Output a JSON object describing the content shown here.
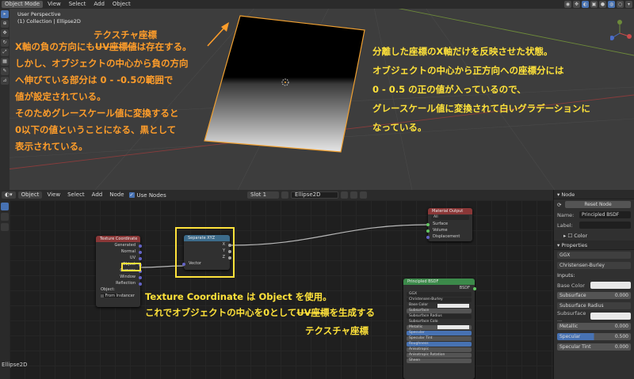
{
  "viewport": {
    "mode": "Object Mode",
    "menus": [
      "View",
      "Select",
      "Add",
      "Object"
    ],
    "info_line1": "User Perspective",
    "info_line2": "(1) Collection | Ellipse2D"
  },
  "annotations": {
    "left_title": "テクスチャ座標",
    "left_line1_a": "X軸の負の方向にも",
    "left_line1_strike": "UV座標値",
    "left_line1_b": "は存在する。",
    "left_line2": "しかし、オブジェクトの中心から負の方向",
    "left_line3": "へ伸びている部分は 0 - -0.5の範囲で",
    "left_line4": "値が設定されている。",
    "left_line5": "そのためグレースケール値に変換すると",
    "left_line6": "0以下の値ということになる、黒として",
    "left_line7": "表示されている。",
    "right_line1": "分離した座標のX軸だけを反映させた状態。",
    "right_line2": "オブジェクトの中心から正方向への座標分には",
    "right_line3": "0 - 0.5 の正の値が入っているので、",
    "right_line4": "グレースケール値に変換されて白いグラデーションに",
    "right_line5": "なっている。",
    "bottom_line1": "Texture Coordinate は Object を使用。",
    "bottom_line2_a": "これでオブジェクトの中心を0として",
    "bottom_line2_strike": "UV座標",
    "bottom_line2_b": "を生成する",
    "bottom_line3": "テクスチャ座標"
  },
  "node_editor": {
    "type_button": "Object",
    "menus": [
      "View",
      "Select",
      "Add",
      "Node"
    ],
    "use_nodes": "Use Nodes",
    "slot": "Slot 1",
    "material": "Ellipse2D",
    "footer": "Ellipse2D",
    "texcoord": {
      "title": "Texture Coordinate",
      "outputs": [
        "Generated",
        "Normal",
        "UV",
        "Object",
        "Camera",
        "Window",
        "Reflection"
      ],
      "object_label": "Object:",
      "from_instancer": "From Instancer"
    },
    "separate": {
      "title": "Separate XYZ",
      "outputs": [
        "X",
        "Y",
        "Z"
      ],
      "input": "Vector"
    },
    "output": {
      "title": "Material Output",
      "target": "All",
      "inputs": [
        "Surface",
        "Volume",
        "Displacement"
      ]
    },
    "bsdf": {
      "title": "Principled BSDF",
      "out": "BSDF",
      "dist": "GGX",
      "sss": "Christensen-Burley",
      "rows": [
        "Base Color",
        "Subsurface",
        "Subsurface Radius",
        "Subsurface Colo",
        "Metallic",
        "Specular",
        "Specular Tint",
        "Roughness",
        "Anisotropic",
        "Anisotropic Rotation",
        "Sheen"
      ]
    }
  },
  "properties": {
    "node_section": "Node",
    "reset_button": "Reset Node",
    "name_label": "Name:",
    "name_value": "Principled BSDF",
    "label_label": "Label:",
    "color_section": "Color",
    "properties_section": "Properties",
    "distribution": "GGX",
    "subsurface_method": "Christensen-Burley",
    "inputs_label": "Inputs:",
    "base_color_label": "Base Color",
    "subsurface_label": "Subsurface",
    "subsurface_value": "0.000",
    "subsurface_radius_label": "Subsurface Radius",
    "subsurface_color_label": "Subsurface ...",
    "metallic_label": "Metallic",
    "metallic_value": "0.000",
    "specular_label": "Specular",
    "specular_value": "0.500",
    "specular_fill": 0.5,
    "specular_tint_label": "Specular Tint",
    "specular_tint_value": "0.000"
  }
}
